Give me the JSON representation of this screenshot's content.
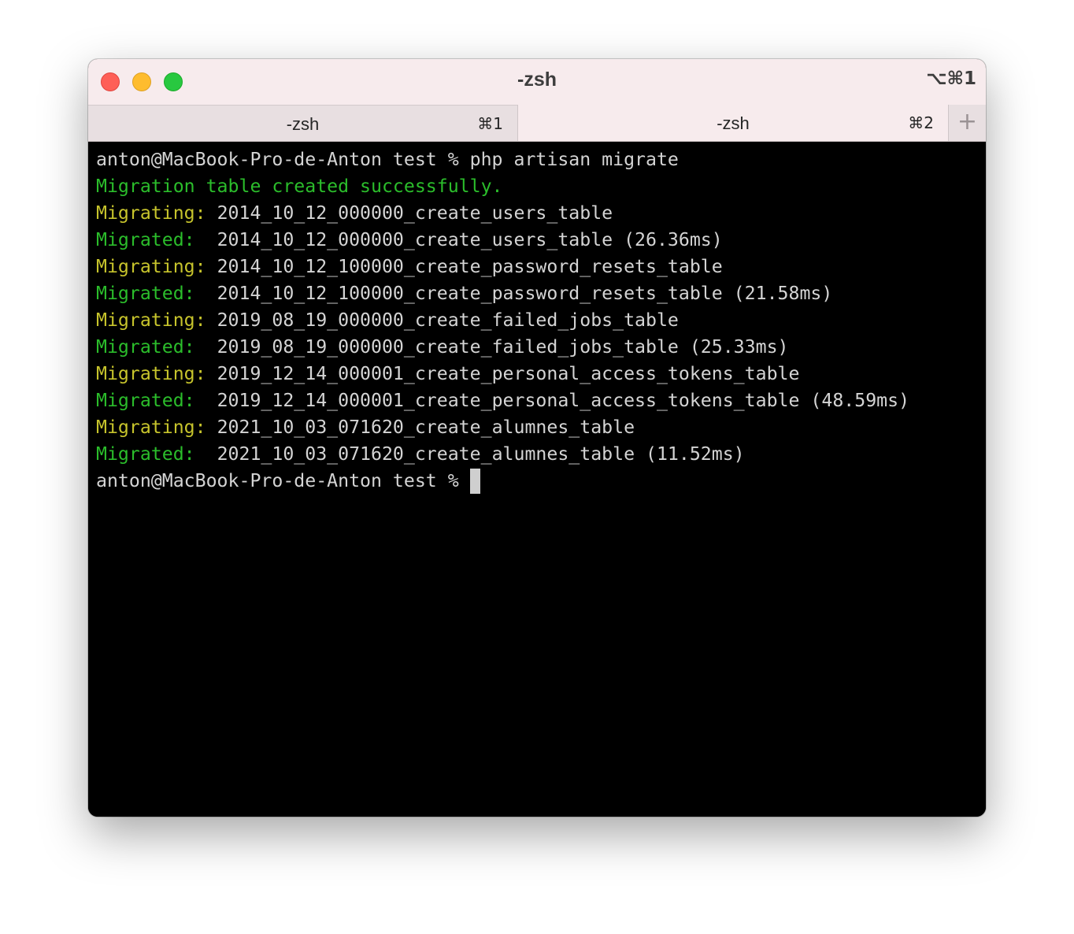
{
  "window": {
    "title": "-zsh",
    "shortcut": "⌥⌘1"
  },
  "tabs": [
    {
      "label": "-zsh",
      "shortcut": "⌘1",
      "active": false
    },
    {
      "label": "-zsh",
      "shortcut": "⌘2",
      "active": true
    }
  ],
  "new_tab_icon": "+",
  "colors": {
    "green": "#2bbd2b",
    "yellow": "#c7c42c",
    "text": "#d4d4d4",
    "background": "#000000"
  },
  "terminal": {
    "lines": [
      {
        "parts": [
          {
            "text": "anton@MacBook-Pro-de-Anton test % php artisan migrate",
            "color": "white"
          }
        ]
      },
      {
        "parts": [
          {
            "text": "Migration table created successfully.",
            "color": "green"
          }
        ]
      },
      {
        "parts": [
          {
            "text": "Migrating: ",
            "color": "yellow"
          },
          {
            "text": "2014_10_12_000000_create_users_table",
            "color": "white"
          }
        ]
      },
      {
        "parts": [
          {
            "text": "Migrated:  ",
            "color": "green"
          },
          {
            "text": "2014_10_12_000000_create_users_table (26.36ms)",
            "color": "white"
          }
        ]
      },
      {
        "parts": [
          {
            "text": "Migrating: ",
            "color": "yellow"
          },
          {
            "text": "2014_10_12_100000_create_password_resets_table",
            "color": "white"
          }
        ]
      },
      {
        "parts": [
          {
            "text": "Migrated:  ",
            "color": "green"
          },
          {
            "text": "2014_10_12_100000_create_password_resets_table (21.58ms)",
            "color": "white"
          }
        ]
      },
      {
        "parts": [
          {
            "text": "Migrating: ",
            "color": "yellow"
          },
          {
            "text": "2019_08_19_000000_create_failed_jobs_table",
            "color": "white"
          }
        ]
      },
      {
        "parts": [
          {
            "text": "Migrated:  ",
            "color": "green"
          },
          {
            "text": "2019_08_19_000000_create_failed_jobs_table (25.33ms)",
            "color": "white"
          }
        ]
      },
      {
        "parts": [
          {
            "text": "Migrating: ",
            "color": "yellow"
          },
          {
            "text": "2019_12_14_000001_create_personal_access_tokens_table",
            "color": "white"
          }
        ]
      },
      {
        "parts": [
          {
            "text": "Migrated:  ",
            "color": "green"
          },
          {
            "text": "2019_12_14_000001_create_personal_access_tokens_table (48.59ms)",
            "color": "white"
          }
        ]
      },
      {
        "parts": [
          {
            "text": "Migrating: ",
            "color": "yellow"
          },
          {
            "text": "2021_10_03_071620_create_alumnes_table",
            "color": "white"
          }
        ]
      },
      {
        "parts": [
          {
            "text": "Migrated:  ",
            "color": "green"
          },
          {
            "text": "2021_10_03_071620_create_alumnes_table (11.52ms)",
            "color": "white"
          }
        ]
      },
      {
        "parts": [
          {
            "text": "anton@MacBook-Pro-de-Anton test % ",
            "color": "white"
          }
        ],
        "cursor": true
      }
    ]
  }
}
